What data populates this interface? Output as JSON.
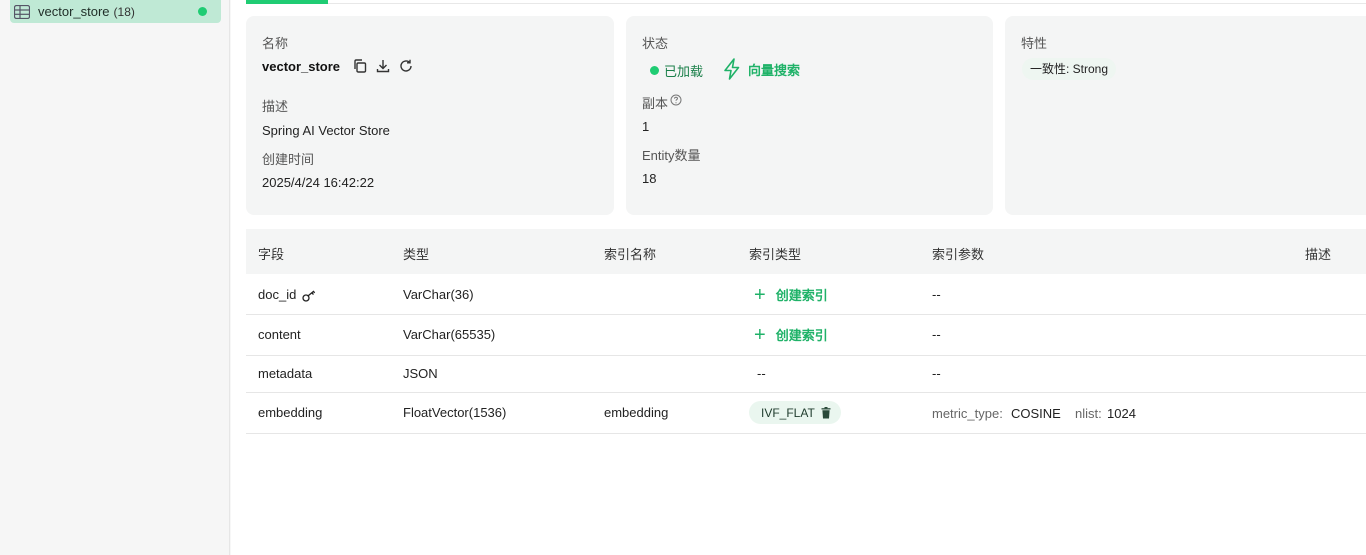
{
  "sidebar": {
    "collection": {
      "name": "vector_store",
      "count": "(18)"
    }
  },
  "overview": {
    "name_label": "名称",
    "name_value": "vector_store",
    "desc_label": "描述",
    "desc_value": "Spring AI Vector Store",
    "created_label": "创建时间",
    "created_value": "2025/4/24 16:42:22",
    "status_label": "状态",
    "status_loaded": "已加载",
    "vector_search": "向量搜索",
    "replica_label": "副本",
    "replica_value": "1",
    "entity_label": "Entity数量",
    "entity_value": "18",
    "features_label": "特性",
    "consistency": "一致性: Strong"
  },
  "schema": {
    "headers": [
      "字段",
      "类型",
      "索引名称",
      "索引类型",
      "索引参数",
      "描述"
    ],
    "rows": [
      {
        "field": "doc_id",
        "type": "VarChar(36)",
        "index_name": "",
        "index_type": "创建索引",
        "params": "--"
      },
      {
        "field": "content",
        "type": "VarChar(65535)",
        "index_name": "",
        "index_type": "创建索引",
        "params": "--"
      },
      {
        "field": "metadata",
        "type": "JSON",
        "index_name": "",
        "index_type": "--",
        "params": "--"
      },
      {
        "field": "embedding",
        "type": "FloatVector(1536)",
        "index_name": "embedding",
        "index_type": "IVF_FLAT",
        "param1_key": "metric_type:",
        "param1_val": "COSINE",
        "param2_key": "nlist:",
        "param2_val": "1024"
      }
    ]
  },
  "colors": {
    "accent": "#1fcc73",
    "accent_text": "#1fb268"
  }
}
